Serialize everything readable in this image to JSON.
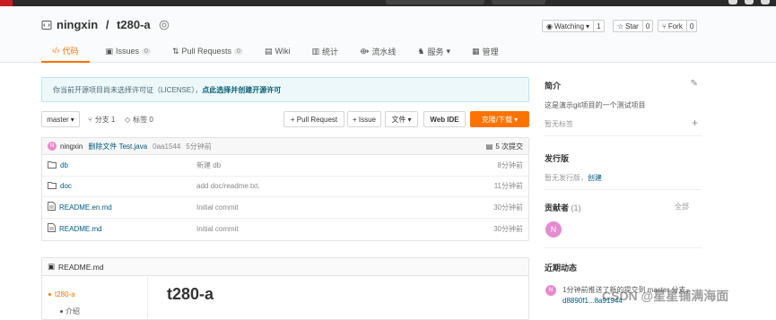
{
  "repo": {
    "owner": "ningxin",
    "sep": " / ",
    "name": "t280-a"
  },
  "actions": {
    "watch_label": "Watching",
    "watch_count": "1",
    "star_label": "Star",
    "star_count": "0",
    "fork_label": "Fork",
    "fork_count": "0"
  },
  "tabs": [
    {
      "label": "代码",
      "count": ""
    },
    {
      "label": "Issues",
      "count": "0"
    },
    {
      "label": "Pull Requests",
      "count": "0"
    },
    {
      "label": "Wiki",
      "count": ""
    },
    {
      "label": "统计",
      "count": ""
    },
    {
      "label": "流水线",
      "count": ""
    },
    {
      "label": "服务",
      "count": ""
    },
    {
      "label": "管理",
      "count": ""
    }
  ],
  "notice": {
    "text": "你当前开源项目尚未选择许可证（LICENSE），",
    "link": "点此选择并创建开源许可"
  },
  "toolbar": {
    "branch": "master",
    "branches": "分支 1",
    "tags": "标签 0",
    "pull_request": "+ Pull Request",
    "issue": "+ Issue",
    "file_menu": "文件",
    "web_ide": "Web IDE",
    "clone": "克隆/下载"
  },
  "commit": {
    "avatar": "N",
    "author": "ningxin",
    "message": "删除文件 Test.java",
    "hash": "0aa1544",
    "time": "5分钟前",
    "count": "5 次提交"
  },
  "files": [
    {
      "type": "folder",
      "name": "db",
      "message": "新建 db",
      "time": "8分钟前"
    },
    {
      "type": "folder",
      "name": "doc",
      "message": "add doc/readme.txt.",
      "time": "11分钟前"
    },
    {
      "type": "file",
      "name": "README.en.md",
      "message": "Initial commit",
      "time": "30分钟前"
    },
    {
      "type": "file",
      "name": "README.md",
      "message": "Initial commit",
      "time": "30分钟前"
    }
  ],
  "readme": {
    "filename": "README.md",
    "toc_item": "t280-a",
    "toc_sub": "介绍",
    "heading": "t280-a"
  },
  "sidebar": {
    "intro_title": "简介",
    "intro_text": "这是演示git项目的一个测试项目",
    "no_tags": "暂无标签",
    "releases_title": "发行版",
    "no_releases": "暂无发行版，",
    "create": "创建",
    "contributors_title": "贡献者",
    "contributors_count": "(1)",
    "all": "全部",
    "contrib_avatar": "N",
    "activity_title": "近期动态",
    "activity_text": "1分钟前推送了新的提交到 master 分支，",
    "activity_hash": "d8890f1...8a91944"
  },
  "watermark": "CSDN @星星铺满海面",
  "colors": {
    "accent": "#fe7300",
    "link": "#005980",
    "avatar": "#e58bd0"
  }
}
